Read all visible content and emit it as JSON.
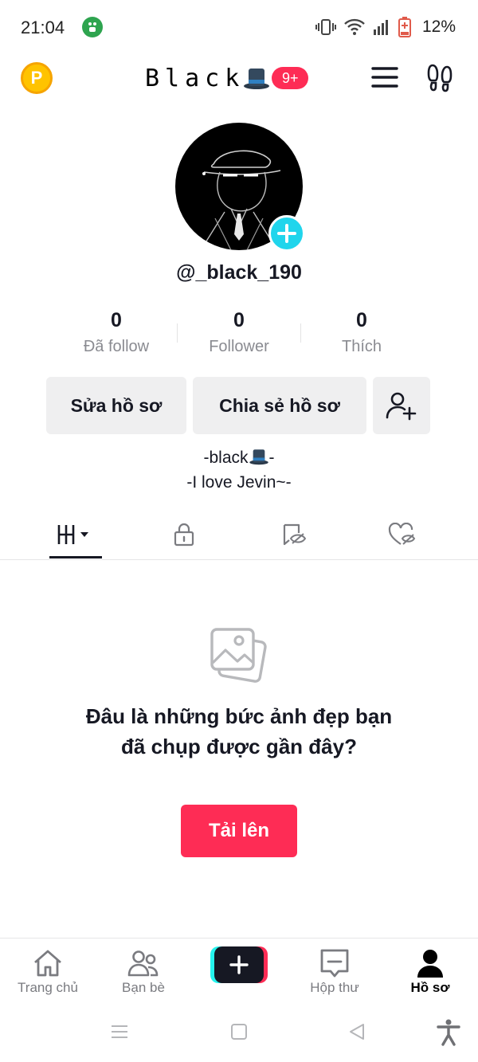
{
  "status_bar": {
    "time": "21:04",
    "battery": "12%"
  },
  "header": {
    "coin_letter": "P",
    "title": "Black",
    "notification_badge": "9+",
    "colors": {
      "badge": "#fe2c55",
      "coin": "#ffc300"
    }
  },
  "profile": {
    "username": "@_black_190",
    "stats": [
      {
        "value": "0",
        "label": "Đã follow"
      },
      {
        "value": "0",
        "label": "Follower"
      },
      {
        "value": "0",
        "label": "Thích"
      }
    ],
    "edit_button": "Sửa hồ sơ",
    "share_button": "Chia sẻ hồ sơ",
    "bio": [
      "-black",
      "-I love Jevin~-"
    ]
  },
  "tabs": {
    "icons": [
      "grid-icon",
      "lock-icon",
      "eye-slash-icon",
      "heart-slash-icon"
    ],
    "active_index": 0
  },
  "empty_state": {
    "message": "Đâu là những bức ảnh đẹp bạn đã chụp được gần đây?",
    "upload_button": "Tải lên"
  },
  "bottom_nav": {
    "items": [
      {
        "label": "Trang chủ",
        "icon": "home-icon"
      },
      {
        "label": "Bạn bè",
        "icon": "friends-icon"
      },
      {
        "label": "",
        "icon": "plus-icon"
      },
      {
        "label": "Hộp thư",
        "icon": "inbox-icon"
      },
      {
        "label": "Hồ sơ",
        "icon": "profile-icon"
      }
    ],
    "active": "Hồ sơ"
  }
}
